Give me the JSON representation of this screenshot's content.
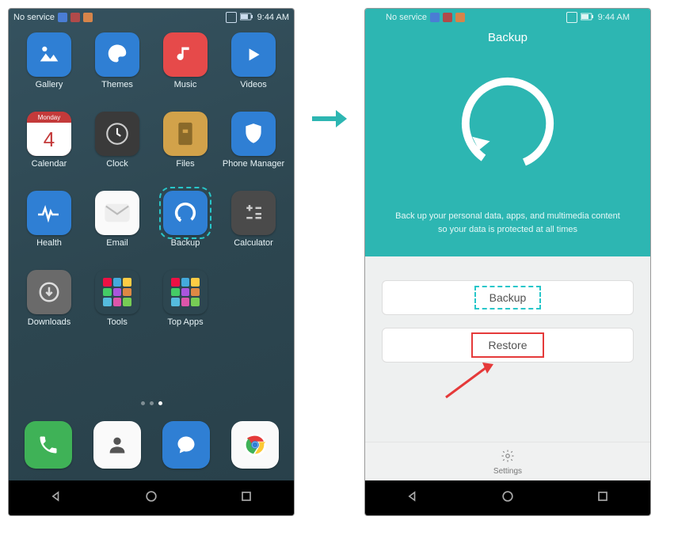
{
  "status": {
    "service": "No service",
    "time": "9:44 AM"
  },
  "left": {
    "apps": [
      {
        "label": "Gallery",
        "bg": "#2f7fd4",
        "icon": "gallery"
      },
      {
        "label": "Themes",
        "bg": "#2f7fd4",
        "icon": "themes"
      },
      {
        "label": "Music",
        "bg": "#e64a4a",
        "icon": "music"
      },
      {
        "label": "Videos",
        "bg": "#2f7fd4",
        "icon": "videos"
      },
      {
        "label": "Calendar",
        "bg": "#e14a4a",
        "icon": "calendar",
        "badge": "Monday",
        "num": "4"
      },
      {
        "label": "Clock",
        "bg": "#3a3a3a",
        "icon": "clock"
      },
      {
        "label": "Files",
        "bg": "#d2a24a",
        "icon": "files"
      },
      {
        "label": "Phone Manager",
        "bg": "#2f7fd4",
        "icon": "shield"
      },
      {
        "label": "Health",
        "bg": "#2f7fd4",
        "icon": "health"
      },
      {
        "label": "Email",
        "bg": "#fafafa",
        "icon": "email"
      },
      {
        "label": "Backup",
        "bg": "#2f7fd4",
        "icon": "backup",
        "highlight": true
      },
      {
        "label": "Calculator",
        "bg": "#4a4a4a",
        "icon": "calc"
      },
      {
        "label": "Downloads",
        "bg": "#6a6a6a",
        "icon": "download"
      },
      {
        "label": "Tools",
        "bg": "#2d4650",
        "icon": "folder"
      },
      {
        "label": "Top Apps",
        "bg": "#2d4650",
        "icon": "folder"
      }
    ]
  },
  "right": {
    "title": "Backup",
    "desc1": "Back up your personal data, apps, and multimedia content",
    "desc2": "so your data is protected at all times",
    "backup_label": "Backup",
    "restore_label": "Restore",
    "settings_label": "Settings"
  }
}
